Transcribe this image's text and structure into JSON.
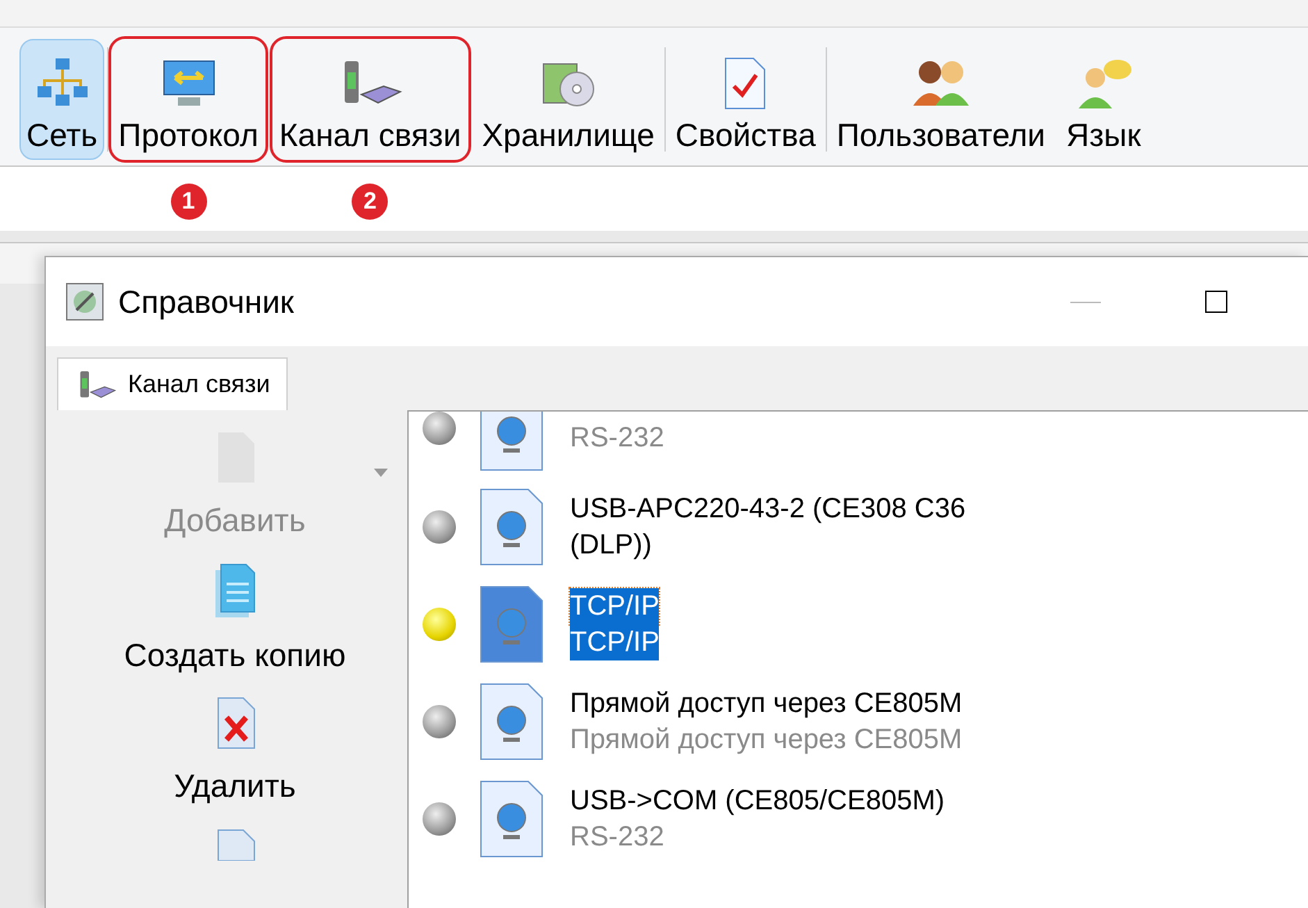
{
  "toolbar": {
    "buttons": [
      {
        "label": "Сеть",
        "kind": "network",
        "selected": true,
        "highlighted": false,
        "group_end": true
      },
      {
        "label": "Протокол",
        "kind": "protocol",
        "selected": false,
        "highlighted": true,
        "callout": "1",
        "group_end": false
      },
      {
        "label": "Канал связи",
        "kind": "channel",
        "selected": false,
        "highlighted": true,
        "callout": "2",
        "group_end": false
      },
      {
        "label": "Хранилище",
        "kind": "storage",
        "selected": false,
        "highlighted": false,
        "group_end": true
      },
      {
        "label": "Свойства",
        "kind": "properties",
        "selected": false,
        "highlighted": false,
        "group_end": true
      },
      {
        "label": "Пользователи",
        "kind": "users",
        "selected": false,
        "highlighted": false,
        "group_end": false
      },
      {
        "label": "Язык",
        "kind": "language",
        "selected": false,
        "highlighted": false,
        "group_end": false
      }
    ]
  },
  "dialog": {
    "title": "Справочник",
    "tabs": [
      {
        "label": "Канал связи",
        "selected": true
      }
    ],
    "actions": [
      {
        "label": "Добавить",
        "kind": "add",
        "disabled": true,
        "dropdown": true
      },
      {
        "label": "Создать копию",
        "kind": "copy",
        "disabled": false,
        "dropdown": false
      },
      {
        "label": "Удалить",
        "kind": "delete",
        "disabled": false,
        "dropdown": false
      },
      {
        "kind": "edit",
        "disabled": false,
        "dropdown": false
      }
    ],
    "channels": [
      {
        "subtitle": "RS-232",
        "active": false,
        "selected": false
      },
      {
        "title": "USB-APC220-43-2 (CE308 C36 (DLP))",
        "active": false,
        "selected": false
      },
      {
        "title": "TCP/IP",
        "subtitle": "TCP/IP",
        "active": true,
        "selected": true
      },
      {
        "title": "Прямой доступ через CE805M",
        "subtitle": "Прямой доступ через CE805M",
        "active": false,
        "selected": false
      },
      {
        "title": "USB->COM (CE805/CE805M)",
        "subtitle": "RS-232",
        "active": false,
        "selected": false
      }
    ]
  }
}
